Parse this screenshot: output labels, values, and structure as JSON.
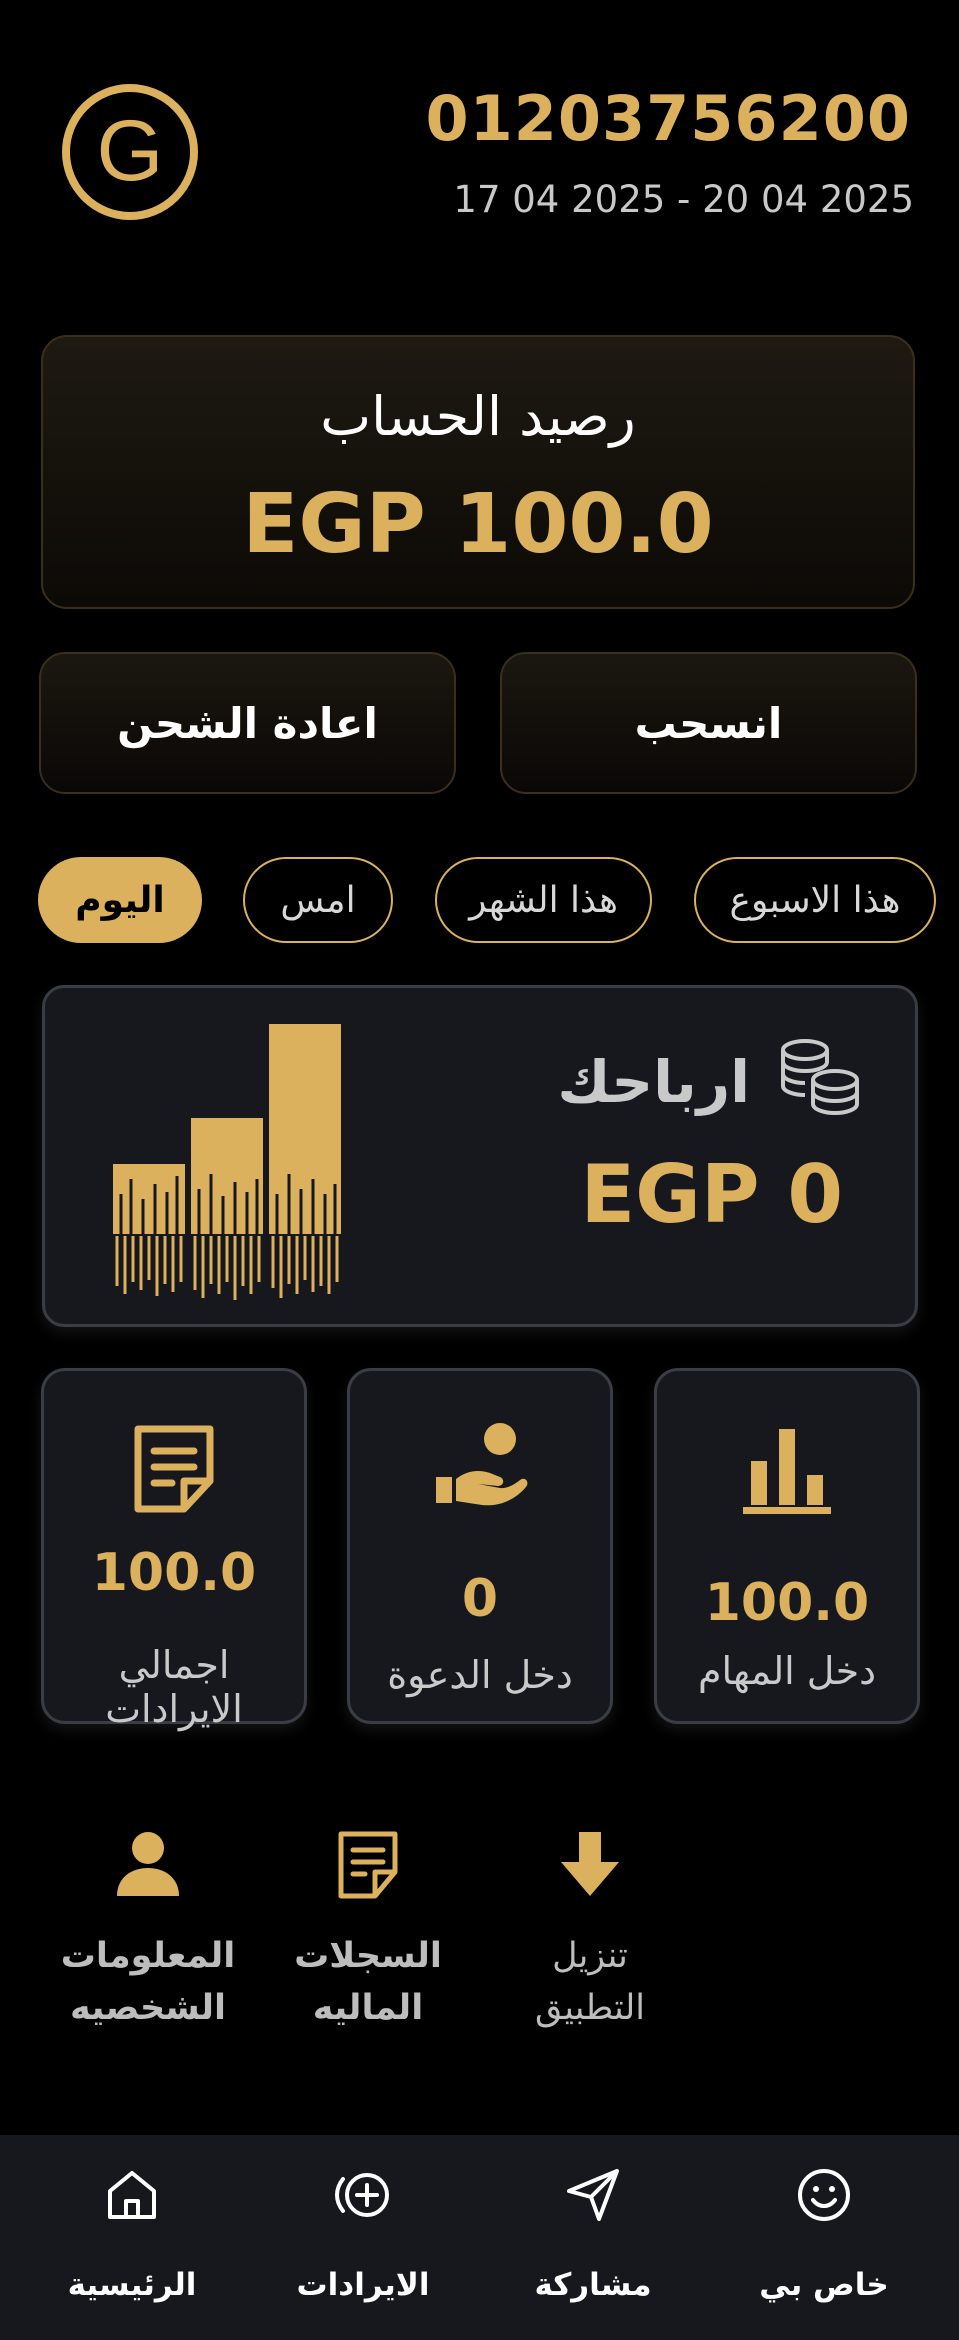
{
  "header": {
    "logo_letter": "G",
    "phone": "01203756200",
    "date_range": "17 04 2025 - 20 04 2025"
  },
  "balance": {
    "title": "رصيد الحساب",
    "amount": "EGP 100.0"
  },
  "actions": {
    "withdraw_label": "انسحب",
    "recharge_label": "اعادة الشحن"
  },
  "filters": {
    "chips": [
      "هذا الاسبوع",
      "هذا الشهر",
      "امس",
      "اليوم"
    ],
    "selected": "اليوم"
  },
  "profits": {
    "label": "ارباحك",
    "amount": "EGP 0"
  },
  "stats": [
    {
      "value": "100.0",
      "label": "دخل المهام"
    },
    {
      "value": "0",
      "label": "دخل الدعوة"
    },
    {
      "value": "100.0",
      "label": "اجمالي الايرادات"
    }
  ],
  "quick_links": [
    {
      "line1": "تنزيل",
      "line2": "التطبيق"
    },
    {
      "line1": "السجلات",
      "line2": "الماليه"
    },
    {
      "line1": "المعلومات",
      "line2": "الشخصيه"
    }
  ],
  "nav": {
    "items": [
      "خاص بي",
      "مشاركة",
      "الايرادات",
      "الرئيسية"
    ]
  },
  "colors": {
    "accent": "#dcb15e",
    "background": "#000000",
    "card": "#16181d"
  }
}
